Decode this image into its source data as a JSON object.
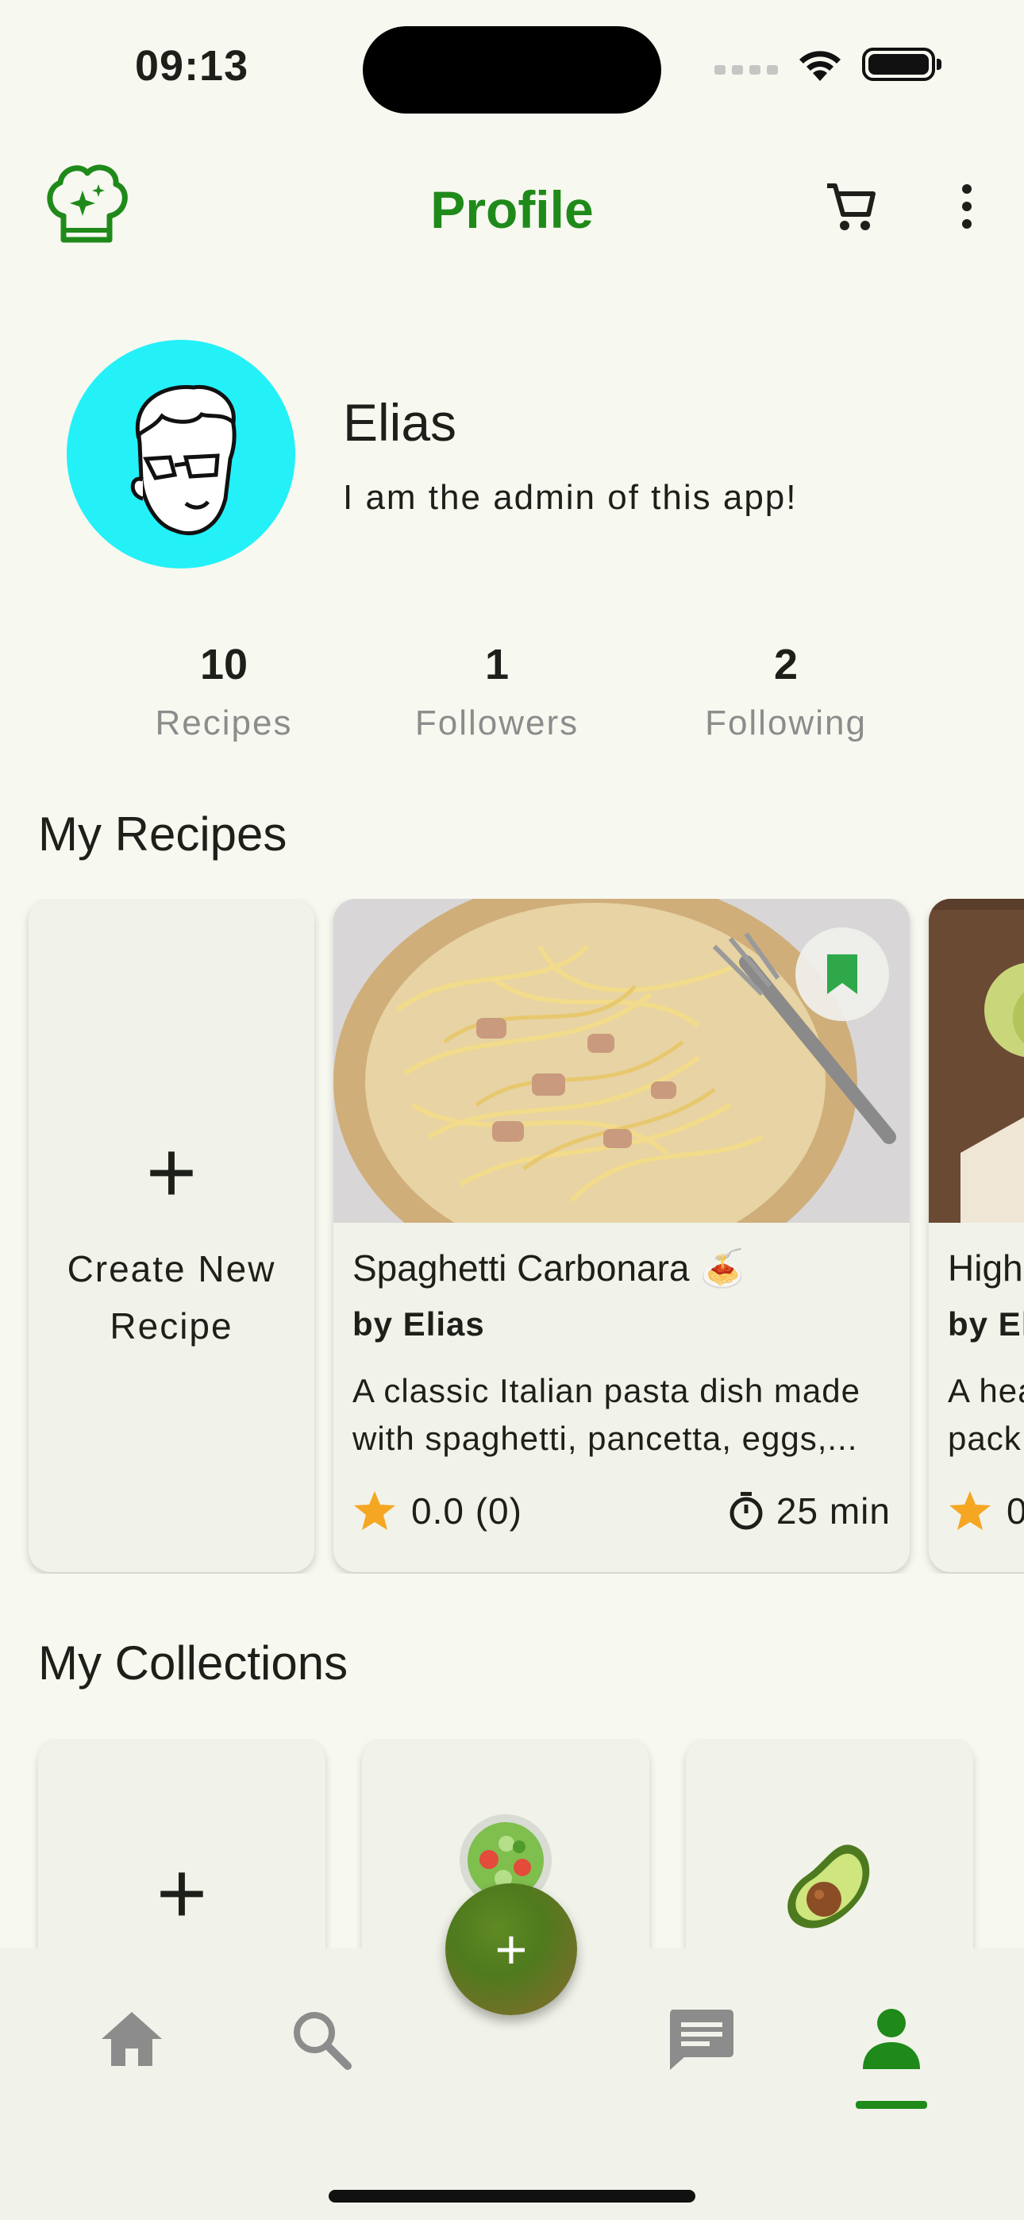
{
  "status_bar": {
    "time": "09:13"
  },
  "app_bar": {
    "title": "Profile",
    "logo_icon": "chef-hat-icon",
    "cart_icon": "cart-icon",
    "more_icon": "more-vert-icon",
    "accent_color": "#1f8a1a"
  },
  "profile": {
    "name": "Elias",
    "bio": "I am the admin of this app!",
    "avatar_bg": "#24f0f8"
  },
  "stats": [
    {
      "value": "10",
      "label": "Recipes"
    },
    {
      "value": "1",
      "label": "Followers"
    },
    {
      "value": "2",
      "label": "Following"
    }
  ],
  "sections": {
    "recipes_title": "My Recipes",
    "collections_title": "My Collections"
  },
  "create_recipe": {
    "label_line1": "Create New",
    "label_line2": "Recipe"
  },
  "recipes": [
    {
      "title": "Spaghetti Carbonara 🍝",
      "author": "by Elias",
      "desc_line1": "A classic Italian pasta dish made",
      "desc_line2": "with spaghetti, pancetta, eggs,...",
      "rating": "0.0 (0)",
      "time": "25 min",
      "bookmarked": true
    },
    {
      "title": "High",
      "author": "by El",
      "desc_line1": "A hea",
      "desc_line2": "pack",
      "rating": "0"
    }
  ],
  "collections": [
    {
      "type": "create"
    },
    {
      "icon": "salad-icon"
    },
    {
      "icon": "avocado-icon"
    }
  ],
  "bottom_nav": {
    "items": [
      "home-icon",
      "search-icon",
      "add-fab",
      "chat-icon",
      "person-icon"
    ],
    "active": "person-icon",
    "peek_label": "."
  }
}
